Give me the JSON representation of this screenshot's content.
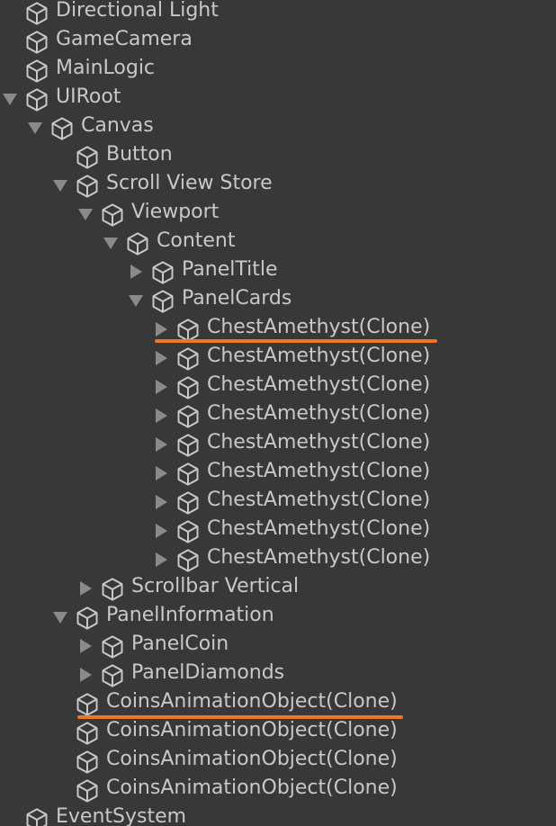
{
  "hierarchy": {
    "items": [
      {
        "label": "Directional Light",
        "expander": "none"
      },
      {
        "label": "GameCamera",
        "expander": "none"
      },
      {
        "label": "MainLogic",
        "expander": "none"
      },
      {
        "label": "UIRoot",
        "expander": "expanded"
      },
      {
        "label": "Canvas",
        "expander": "expanded"
      },
      {
        "label": "Button",
        "expander": "none"
      },
      {
        "label": "Scroll View Store",
        "expander": "expanded"
      },
      {
        "label": "Viewport",
        "expander": "expanded"
      },
      {
        "label": "Content",
        "expander": "expanded"
      },
      {
        "label": "PanelTitle",
        "expander": "collapsed"
      },
      {
        "label": "PanelCards",
        "expander": "expanded"
      },
      {
        "label": "ChestAmethyst(Clone)",
        "expander": "collapsed"
      },
      {
        "label": "ChestAmethyst(Clone)",
        "expander": "collapsed"
      },
      {
        "label": "ChestAmethyst(Clone)",
        "expander": "collapsed"
      },
      {
        "label": "ChestAmethyst(Clone)",
        "expander": "collapsed"
      },
      {
        "label": "ChestAmethyst(Clone)",
        "expander": "collapsed"
      },
      {
        "label": "ChestAmethyst(Clone)",
        "expander": "collapsed"
      },
      {
        "label": "ChestAmethyst(Clone)",
        "expander": "collapsed"
      },
      {
        "label": "ChestAmethyst(Clone)",
        "expander": "collapsed"
      },
      {
        "label": "ChestAmethyst(Clone)",
        "expander": "collapsed"
      },
      {
        "label": "Scrollbar Vertical",
        "expander": "collapsed"
      },
      {
        "label": "PanelInformation",
        "expander": "expanded"
      },
      {
        "label": "PanelCoin",
        "expander": "collapsed"
      },
      {
        "label": "PanelDiamonds",
        "expander": "collapsed"
      },
      {
        "label": "CoinsAnimationObject(Clone)",
        "expander": "none"
      },
      {
        "label": "CoinsAnimationObject(Clone)",
        "expander": "none"
      },
      {
        "label": "CoinsAnimationObject(Clone)",
        "expander": "none"
      },
      {
        "label": "CoinsAnimationObject(Clone)",
        "expander": "none"
      },
      {
        "label": "EventSystem",
        "expander": "none"
      }
    ]
  },
  "colors": {
    "background": "#383838",
    "text": "#c8c8c8",
    "icon": "#c8c8c8",
    "expander": "#8a8a8a",
    "highlight": "#f0761e"
  },
  "icons": {
    "gameobject": "cube-icon"
  }
}
